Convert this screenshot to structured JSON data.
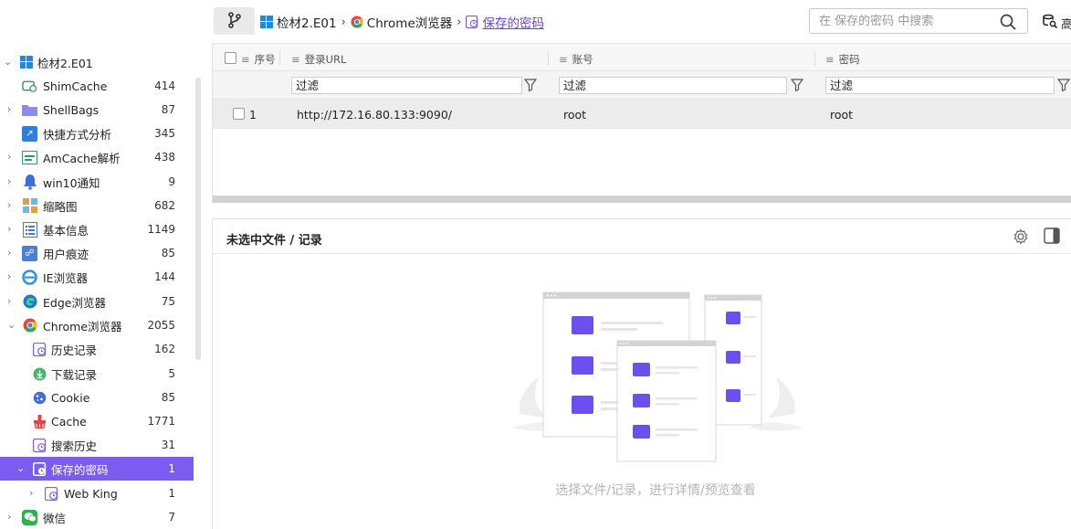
{
  "sidebar": {
    "items": [
      {
        "label": "检材2.E01",
        "count": "",
        "icon": "windows-icon",
        "color": "#1e88e5"
      },
      {
        "label": "ShimCache",
        "count": "414",
        "icon": "shimcache-icon",
        "color": "#2e9e57"
      },
      {
        "label": "ShellBags",
        "count": "87",
        "icon": "folder-icon",
        "color": "#8c8cf0"
      },
      {
        "label": "快捷方式分析",
        "count": "345",
        "icon": "shortcut-icon",
        "color": "#2f7fd8"
      },
      {
        "label": "AmCache解析",
        "count": "438",
        "icon": "amcache-icon",
        "color": "#2a9d6b"
      },
      {
        "label": "win10通知",
        "count": "9",
        "icon": "bell-icon",
        "color": "#3b6fe0"
      },
      {
        "label": "缩略图",
        "count": "682",
        "icon": "thumbnail-icon",
        "color": "#e0a040"
      },
      {
        "label": "基本信息",
        "count": "1149",
        "icon": "list-icon",
        "color": "#3a7bd5"
      },
      {
        "label": "用户痕迹",
        "count": "85",
        "icon": "user-trace-icon",
        "color": "#4a7fd8"
      },
      {
        "label": "IE浏览器",
        "count": "144",
        "icon": "ie-icon",
        "color": "#2d8fe8"
      },
      {
        "label": "Edge浏览器",
        "count": "75",
        "icon": "edge-icon",
        "color": "#1f7ac9"
      },
      {
        "label": "Chrome浏览器",
        "count": "2055",
        "icon": "chrome-icon",
        "color": "#e44a3c"
      },
      {
        "label": "历史记录",
        "count": "162",
        "icon": "history-icon",
        "color": "#7b5cf0"
      },
      {
        "label": "下载记录",
        "count": "5",
        "icon": "download-icon",
        "color": "#47b36b"
      },
      {
        "label": "Cookie",
        "count": "85",
        "icon": "cookie-icon",
        "color": "#3b6fe0"
      },
      {
        "label": "Cache",
        "count": "1771",
        "icon": "cache-icon",
        "color": "#e04848"
      },
      {
        "label": "搜索历史",
        "count": "31",
        "icon": "search-history-icon",
        "color": "#7b5cf0"
      },
      {
        "label": "保存的密码",
        "count": "1",
        "icon": "password-icon",
        "color": "#7b5cf0"
      },
      {
        "label": "Web King",
        "count": "1",
        "icon": "password-icon",
        "color": "#7b5cf0"
      },
      {
        "label": "微信",
        "count": "7",
        "icon": "wechat-icon",
        "color": "#2bb34a"
      }
    ]
  },
  "breadcrumb": {
    "root": "检材2.E01",
    "parent": "Chrome浏览器",
    "current": "保存的密码"
  },
  "search": {
    "placeholder": "在 保存的密码 中搜索"
  },
  "top_right": {
    "label": "高"
  },
  "grid": {
    "columns": [
      "序号",
      "登录URL",
      "账号",
      "密码"
    ],
    "filter_placeholder": "过滤",
    "rows": [
      {
        "index": "1",
        "url": "http://172.16.80.133:9090/",
        "account": "root",
        "password": "root"
      }
    ]
  },
  "detail": {
    "title": "未选中文件 / 记录",
    "empty_hint": "选择文件/记录，进行详情/预览查看"
  },
  "colors": {
    "accent": "#7b5cf0",
    "selected_row": "#ececec"
  }
}
